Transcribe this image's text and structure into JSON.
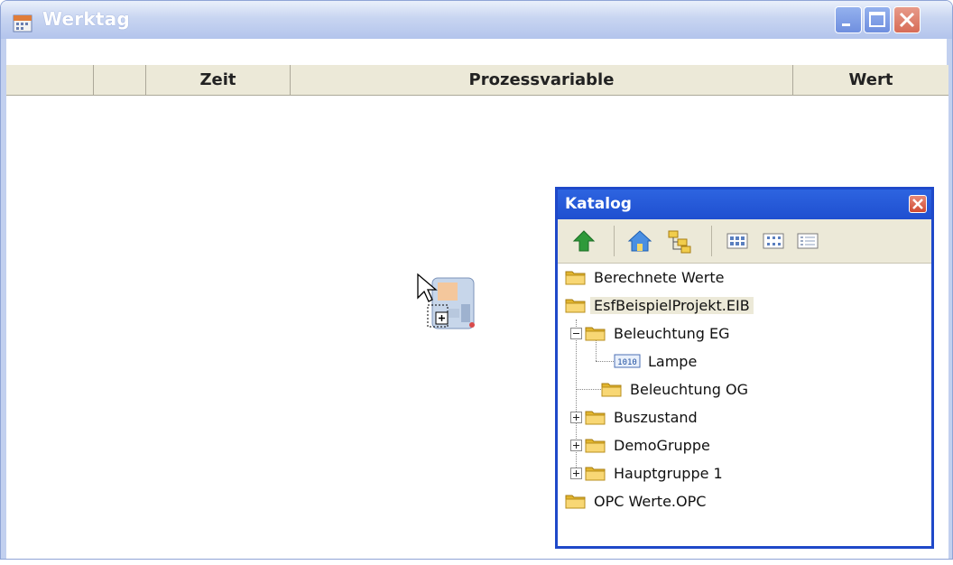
{
  "window": {
    "title": "Werktag"
  },
  "table": {
    "columns": [
      "",
      "",
      "Zeit",
      "Prozessvariable",
      "Wert"
    ]
  },
  "katalog": {
    "title": "Katalog",
    "toolbar": {
      "icons": [
        "up-arrow-icon",
        "home-icon",
        "tree-icon",
        "large-icons-view-icon",
        "small-icons-view-icon",
        "details-view-icon"
      ]
    },
    "tree": [
      {
        "label": "Berechnete Werte"
      },
      {
        "label": "EsfBeispielProjekt.EIB",
        "selected": true
      },
      {
        "label": "Beleuchtung EG",
        "expanded": true
      },
      {
        "label": "Lampe"
      },
      {
        "label": "Beleuchtung OG"
      },
      {
        "label": "Buszustand",
        "expandable": true
      },
      {
        "label": "DemoGruppe",
        "expandable": true
      },
      {
        "label": "Hauptgruppe 1",
        "expandable": true
      },
      {
        "label": "OPC Werte.OPC"
      }
    ]
  },
  "colors": {
    "title_bar": "#b3c4ec",
    "katalog_border": "#1f49c9",
    "header_bg": "#ece9d8"
  }
}
